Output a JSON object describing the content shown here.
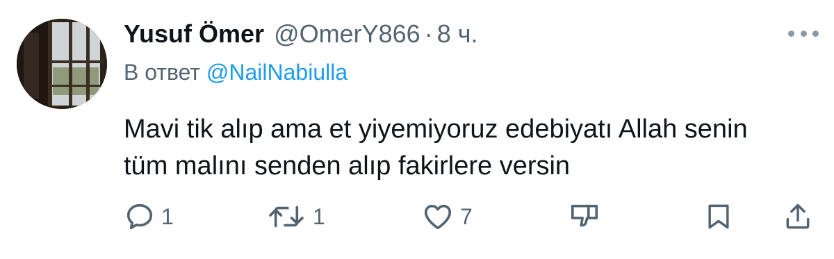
{
  "tweet": {
    "display_name": "Yusuf Ömer",
    "handle": "@OmerY866",
    "separator": "·",
    "time": "8 ч.",
    "reply_prefix": "В ответ",
    "reply_to": "@NailNabiulla",
    "text": "Mavi tik alıp ama et yiyemiyoruz edebiyatı Allah senin tüm malını senden alıp fakirlere versin"
  },
  "actions": {
    "reply_count": "1",
    "retweet_count": "1",
    "like_count": "7"
  },
  "icons": {
    "more": "more-horizontal-icon",
    "reply": "reply-bubble-icon",
    "retweet": "retweet-icon",
    "like": "heart-icon",
    "downvote": "thumbs-down-icon",
    "bookmark": "bookmark-icon",
    "share": "share-icon"
  },
  "colors": {
    "text_primary": "#0f1419",
    "text_secondary": "#536471",
    "accent": "#1d9bf0"
  }
}
